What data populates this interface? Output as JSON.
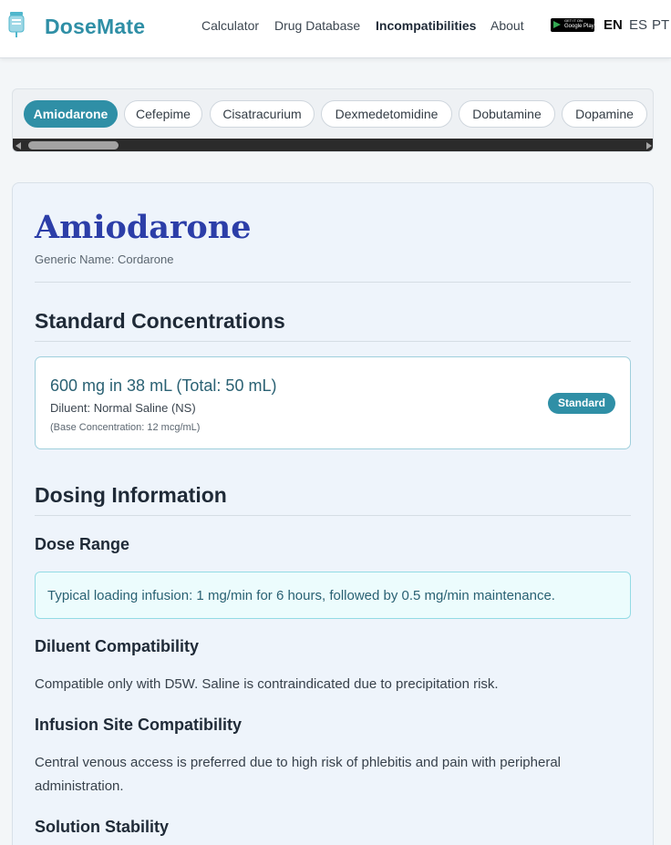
{
  "header": {
    "brand": "DoseMate",
    "nav": [
      "Calculator",
      "Drug Database",
      "Incompatibilities",
      "About"
    ],
    "active_nav": "Incompatibilities",
    "play_badge": {
      "line1": "GET IT ON",
      "line2": "Google Play"
    },
    "languages": [
      "EN",
      "ES",
      "PT"
    ],
    "active_language": "EN"
  },
  "drug_chips": {
    "items": [
      "Amiodarone",
      "Cefepime",
      "Cisatracurium",
      "Dexmedetomidine",
      "Dobutamine",
      "Dopamine"
    ],
    "active": "Amiodarone"
  },
  "drug": {
    "name": "Amiodarone",
    "generic_name": "Generic Name: Cordarone",
    "concentrations_title": "Standard Concentrations",
    "concentration": {
      "main": "600 mg in 38 mL (Total: 50 mL)",
      "diluent": "Diluent: Normal Saline (NS)",
      "base": "(Base Concentration: 12 mcg/mL)",
      "badge": "Standard"
    },
    "dosing_title": "Dosing Information",
    "dose_range_title": "Dose Range",
    "dose_range_text": "Typical loading infusion: 1 mg/min for 6 hours, followed by 0.5 mg/min maintenance.",
    "diluent_compat_title": "Diluent Compatibility",
    "diluent_compat_text": "Compatible only with D5W. Saline is contraindicated due to precipitation risk.",
    "infusion_site_title": "Infusion Site Compatibility",
    "infusion_site_text": "Central venous access is preferred due to high risk of phlebitis and pain with peripheral administration.",
    "stability_title": "Solution Stability"
  },
  "colors": {
    "brand": "#2f8fa6",
    "title": "#2c3ea8",
    "info_bg": "#ecfcfd"
  }
}
